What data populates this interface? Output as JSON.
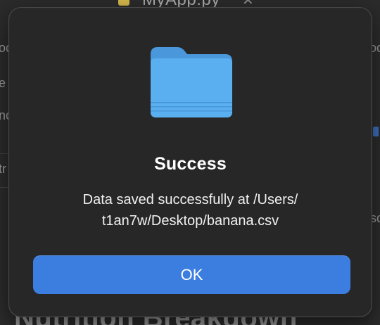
{
  "background": {
    "tab_title": "MyApp.py",
    "tab_close_glyph": "✕",
    "left_fragments": [
      "oc",
      "e",
      "nc",
      "tr"
    ],
    "right_fragments": [
      "oc",
      "sc"
    ],
    "bottom_title": "Nutrition Breakdown"
  },
  "dialog": {
    "icon": "folder-icon",
    "title": "Success",
    "message_line_1": "Data saved successfully at /Users/",
    "message_line_2": "t1an7w/Desktop/banana.csv",
    "ok_label": "OK"
  },
  "colors": {
    "dialog_bg": "#272727",
    "button_bg": "#3c7ee0",
    "folder_blue": "#5aaff0"
  }
}
